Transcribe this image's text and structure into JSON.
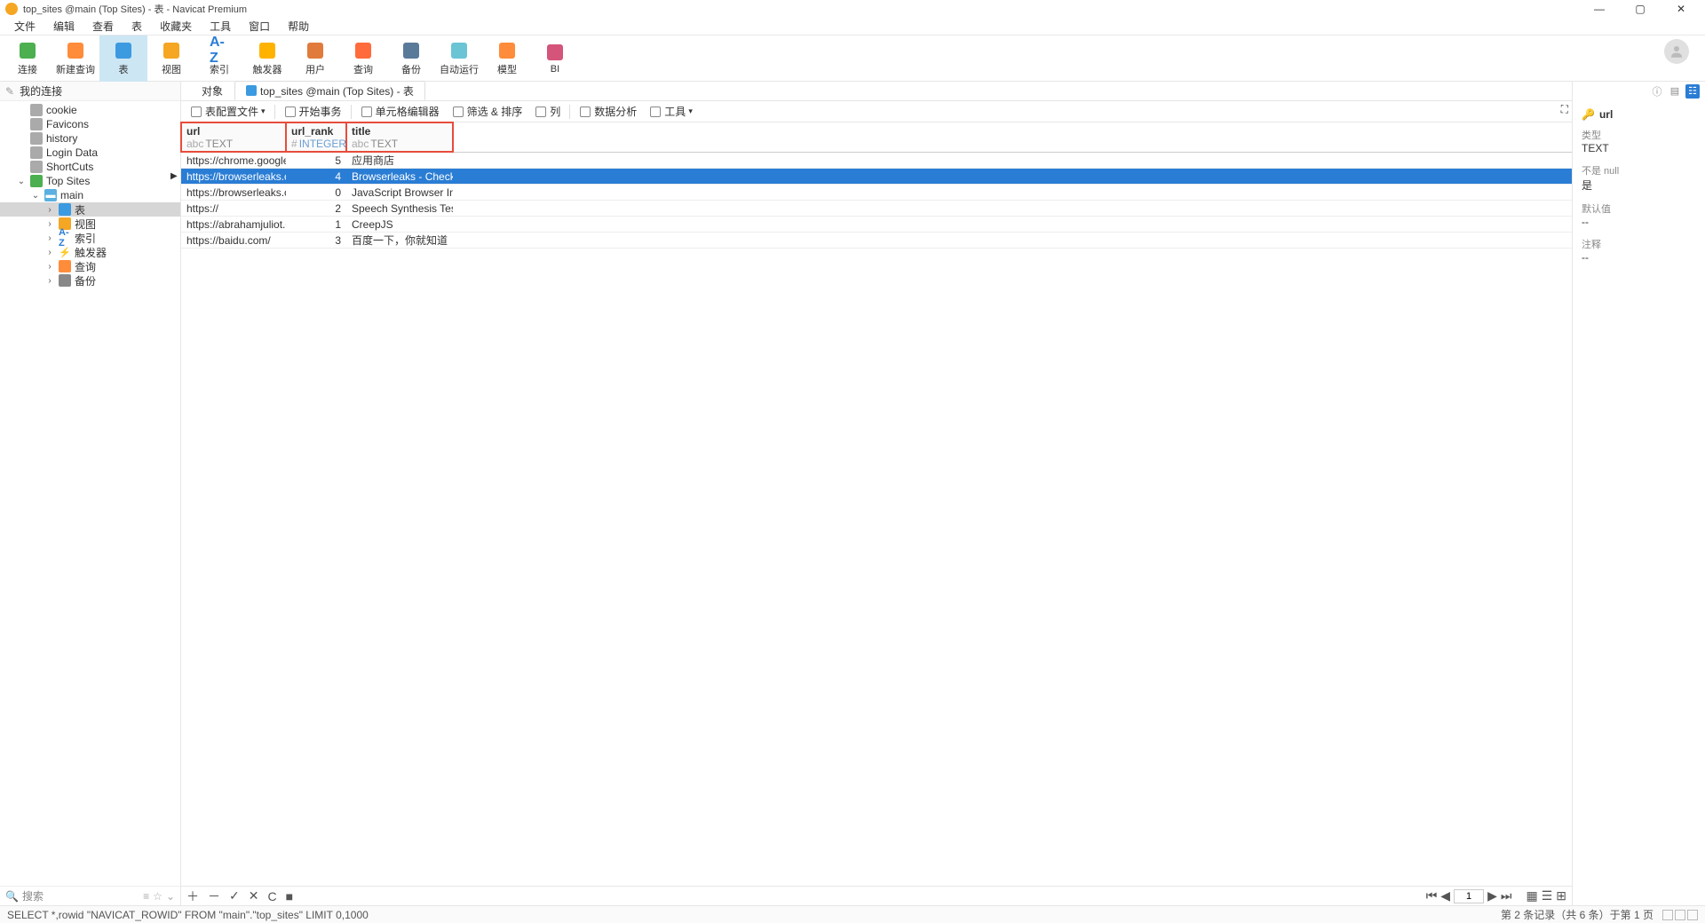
{
  "window_title": "top_sites @main (Top Sites) - 表 - Navicat Premium",
  "menu": [
    "文件",
    "编辑",
    "查看",
    "表",
    "收藏夹",
    "工具",
    "窗口",
    "帮助"
  ],
  "toolbar": [
    {
      "id": "connect",
      "label": "连接",
      "color": "#4caf50"
    },
    {
      "id": "newquery",
      "label": "新建查询",
      "color": "#ff8c3b"
    },
    {
      "id": "table",
      "label": "表",
      "color": "#3b9ae0",
      "selected": true
    },
    {
      "id": "view",
      "label": "视图",
      "color": "#f5a623"
    },
    {
      "id": "index",
      "label": "索引",
      "color": "#2a7dd4",
      "text": "A-Z"
    },
    {
      "id": "trigger",
      "label": "触发器",
      "color": "#ffb300"
    },
    {
      "id": "user",
      "label": "用户",
      "color": "#e07b3b"
    },
    {
      "id": "query",
      "label": "查询",
      "color": "#ff6b3b"
    },
    {
      "id": "backup",
      "label": "备份",
      "color": "#5a7a9a"
    },
    {
      "id": "auto",
      "label": "自动运行",
      "color": "#6ac4d4"
    },
    {
      "id": "model",
      "label": "模型",
      "color": "#ff8c3b"
    },
    {
      "id": "bi",
      "label": "BI",
      "color": "#d4547a"
    }
  ],
  "sidebar": {
    "title": "我的连接",
    "items": [
      {
        "label": "cookie",
        "icon": "gray",
        "ind": 1
      },
      {
        "label": "Favicons",
        "icon": "gray",
        "ind": 1
      },
      {
        "label": "history",
        "icon": "gray",
        "ind": 1
      },
      {
        "label": "Login Data",
        "icon": "gray",
        "ind": 1
      },
      {
        "label": "ShortCuts",
        "icon": "gray",
        "ind": 1
      },
      {
        "label": "Top Sites",
        "icon": "green",
        "ind": 1,
        "tw": "⌄",
        "open": true
      },
      {
        "label": "main",
        "icon": "db",
        "ind": 2,
        "tw": "⌄",
        "open": true
      },
      {
        "label": "表",
        "icon": "table",
        "ind": 3,
        "tw": "›",
        "sel": true
      },
      {
        "label": "视图",
        "icon": "view",
        "ind": 3,
        "tw": "›"
      },
      {
        "label": "索引",
        "icon": "az",
        "ind": 3,
        "tw": "›"
      },
      {
        "label": "触发器",
        "icon": "trig",
        "ind": 3,
        "tw": "›"
      },
      {
        "label": "查询",
        "icon": "query",
        "ind": 3,
        "tw": "›"
      },
      {
        "label": "备份",
        "icon": "backup",
        "ind": 3,
        "tw": "›"
      }
    ],
    "search": "搜索"
  },
  "tabs": [
    {
      "label": "对象",
      "sel": false
    },
    {
      "label": "top_sites @main (Top Sites) - 表",
      "sel": true
    }
  ],
  "subtoolbar": [
    {
      "label": "表配置文件",
      "drop": true
    },
    {
      "sep": true
    },
    {
      "label": "开始事务"
    },
    {
      "sep": true
    },
    {
      "label": "单元格编辑器"
    },
    {
      "label": "筛选 & 排序"
    },
    {
      "label": "列"
    },
    {
      "sep": true
    },
    {
      "label": "数据分析"
    },
    {
      "label": "工具",
      "drop": true
    }
  ],
  "columns": [
    {
      "name": "url",
      "type": "TEXT",
      "w": "col1",
      "hl": true,
      "typeicon": "abc"
    },
    {
      "name": "url_rank",
      "type": "INTEGER",
      "w": "col2",
      "hl": true,
      "typeicon": "#"
    },
    {
      "name": "title",
      "type": "TEXT",
      "w": "col3",
      "hl": true,
      "typeicon": "abc"
    }
  ],
  "rows": [
    {
      "url": "https://chrome.google.c",
      "rank": "5",
      "title": "应用商店"
    },
    {
      "url": "https://browserleaks.com",
      "rank": "4",
      "title": "Browserleaks - Check yo",
      "sel": true,
      "mark": "▶"
    },
    {
      "url": "https://browserleaks.com",
      "rank": "0",
      "title": "JavaScript Browser Infor"
    },
    {
      "url": "https://           ",
      "rank": "2",
      "title": "Speech Synthesis Test"
    },
    {
      "url": "https://abrahamjuliot.git",
      "rank": "1",
      "title": "CreepJS"
    },
    {
      "url": "https://baidu.com/",
      "rank": "3",
      "title": "百度一下，你就知道"
    }
  ],
  "gridfoot": {
    "page": "1",
    "view_icons": [
      "☰",
      "▦",
      "⊞"
    ]
  },
  "status": {
    "sql": "SELECT *,rowid \"NAVICAT_ROWID\" FROM \"main\".\"top_sites\" LIMIT 0,1000",
    "right": "第 2 条记录（共 6 条）于第 1 页"
  },
  "rightpanel": {
    "field": "url",
    "type_label": "类型",
    "type_value": "TEXT",
    "notnull_label": "不是 null",
    "notnull_value": "是",
    "default_label": "默认值",
    "default_value": "--",
    "comment_label": "注释",
    "comment_value": "--"
  }
}
